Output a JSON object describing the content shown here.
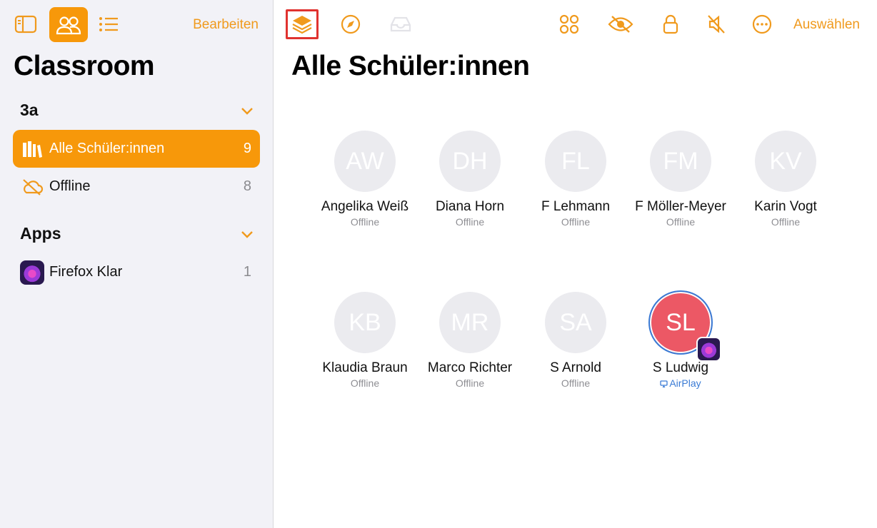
{
  "sidebar": {
    "toolbar": {
      "edit_label": "Bearbeiten",
      "toggle_icon": "sidebar-icon",
      "people_icon": "people-icon",
      "list_icon": "list-icon"
    },
    "title": "Classroom",
    "groups": {
      "header": "3a",
      "items": [
        {
          "label": "Alle Schüler:innen",
          "count": "9",
          "icon": "books-icon",
          "active": true
        },
        {
          "label": "Offline",
          "count": "8",
          "icon": "cloud-offline-icon",
          "active": false
        }
      ]
    },
    "apps": {
      "header": "Apps",
      "items": [
        {
          "label": "Firefox Klar",
          "count": "1",
          "icon": "firefox-klar-icon"
        }
      ]
    }
  },
  "main": {
    "toolbar": {
      "select_label": "Auswählen",
      "icons": [
        "layers-icon",
        "compass-icon",
        "tray-icon",
        "apps-grid-icon",
        "eye-slash-icon",
        "lock-icon",
        "speaker-mute-icon",
        "more-icon"
      ]
    },
    "title": "Alle Schüler:innen",
    "students": [
      {
        "initials": "AW",
        "name": "Angelika Weiß",
        "status": "Offline"
      },
      {
        "initials": "DH",
        "name": "Diana Horn",
        "status": "Offline"
      },
      {
        "initials": "FL",
        "name": "F Lehmann",
        "status": "Offline"
      },
      {
        "initials": "FM",
        "name": "F Möller-Meyer",
        "status": "Offline"
      },
      {
        "initials": "KV",
        "name": "Karin Vogt",
        "status": "Offline"
      },
      {
        "initials": "KB",
        "name": "Klaudia Braun",
        "status": "Offline"
      },
      {
        "initials": "MR",
        "name": "Marco Richter",
        "status": "Offline"
      },
      {
        "initials": "SA",
        "name": "S Arnold",
        "status": "Offline"
      },
      {
        "initials": "SL",
        "name": "S Ludwig",
        "status": "AirPlay"
      }
    ]
  },
  "colors": {
    "accent": "#f7980a",
    "highlight_border": "#e0322f",
    "active_avatar": "#ec5865",
    "airplay": "#3a7bd5"
  }
}
